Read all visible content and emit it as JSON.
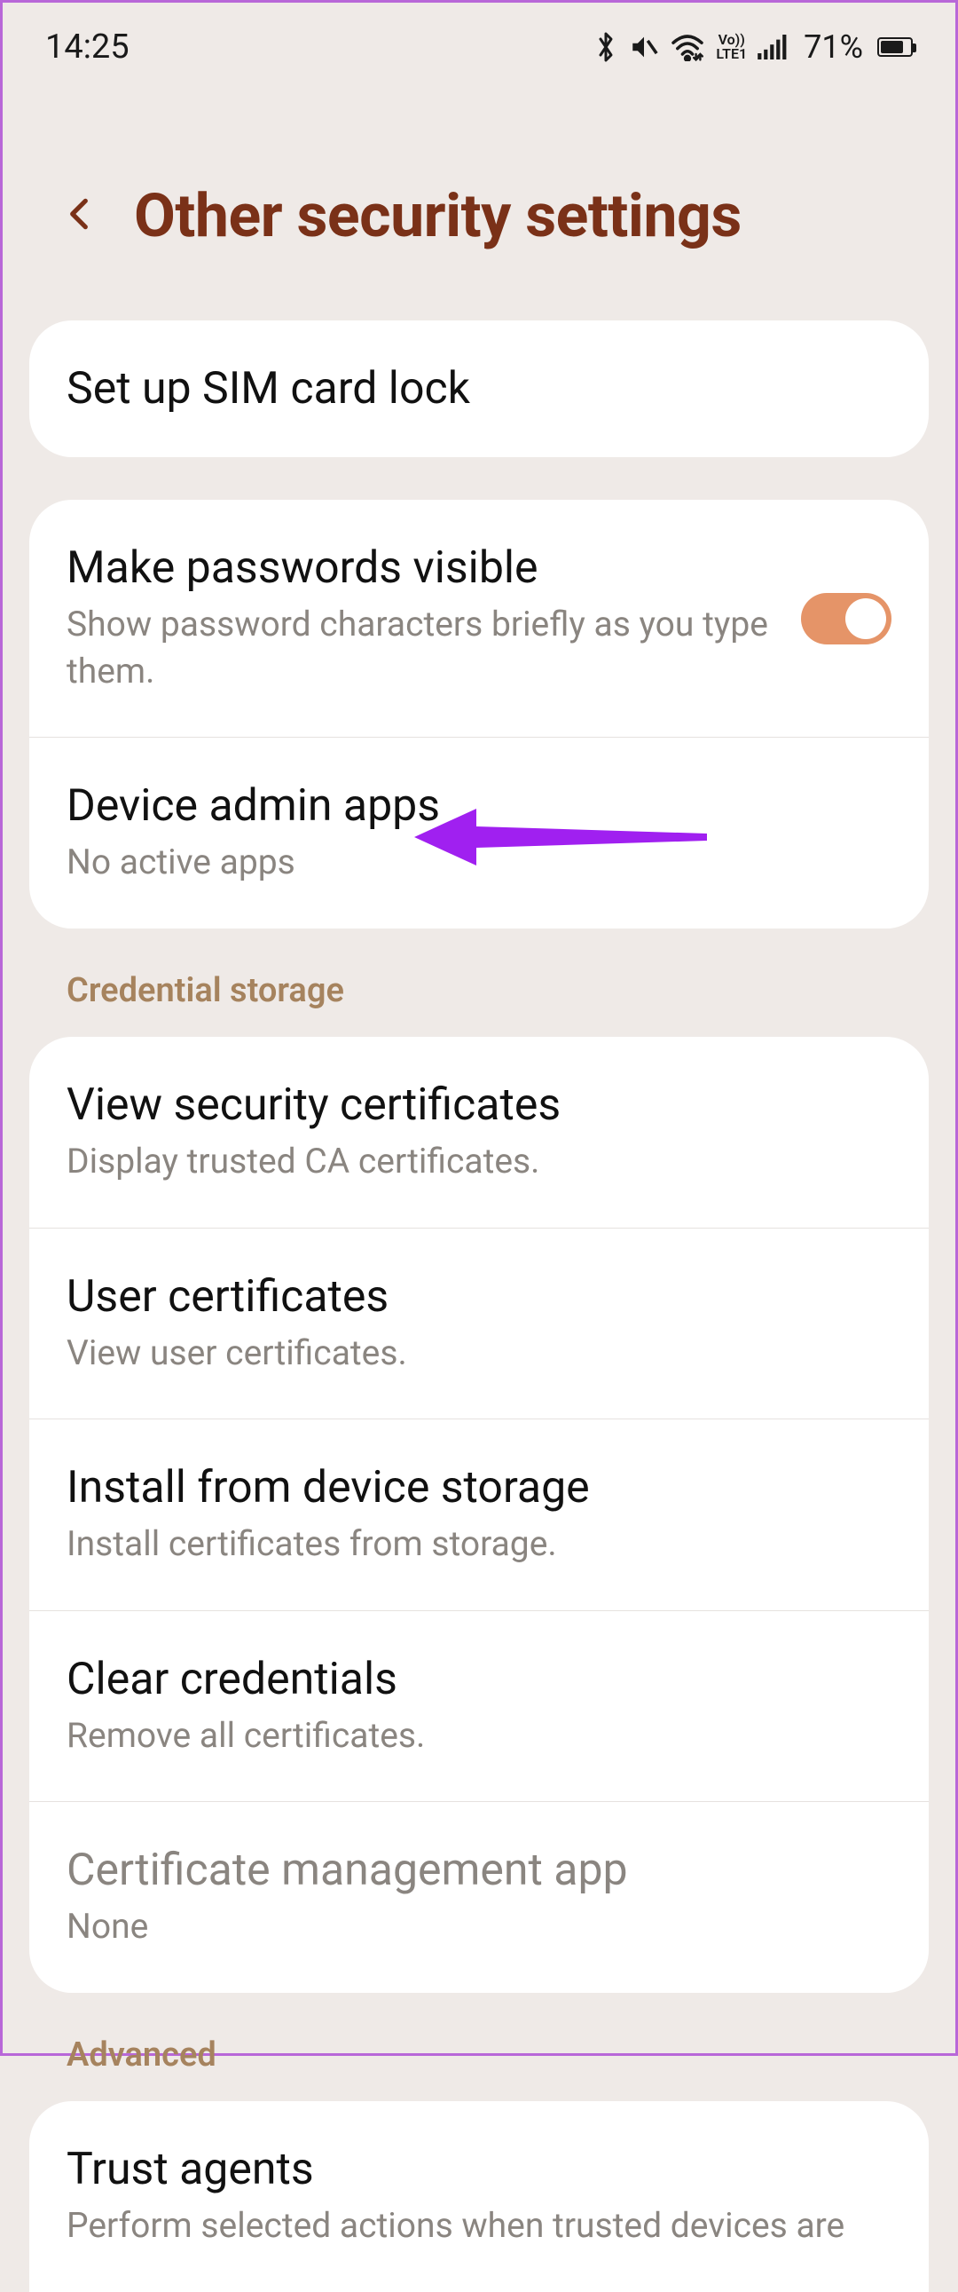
{
  "status": {
    "time": "14:25",
    "battery_pct": "71%"
  },
  "header": {
    "title": "Other security settings"
  },
  "group1": {
    "sim_lock": {
      "title": "Set up SIM card lock"
    }
  },
  "group2": {
    "passwords_visible": {
      "title": "Make passwords visible",
      "sub": "Show password characters briefly as you type them.",
      "toggle": true
    },
    "device_admin": {
      "title": "Device admin apps",
      "sub": "No active apps"
    }
  },
  "sections": {
    "credential": "Credential storage",
    "advanced": "Advanced"
  },
  "credential": {
    "view_certs": {
      "title": "View security certificates",
      "sub": "Display trusted CA certificates."
    },
    "user_certs": {
      "title": "User certificates",
      "sub": "View user certificates."
    },
    "install_storage": {
      "title": "Install from device storage",
      "sub": "Install certificates from storage."
    },
    "clear_creds": {
      "title": "Clear credentials",
      "sub": "Remove all certificates."
    },
    "cert_mgmt": {
      "title": "Certificate management app",
      "sub": "None"
    }
  },
  "advanced": {
    "trust_agents": {
      "title": "Trust agents",
      "sub": "Perform selected actions when trusted devices are"
    }
  }
}
